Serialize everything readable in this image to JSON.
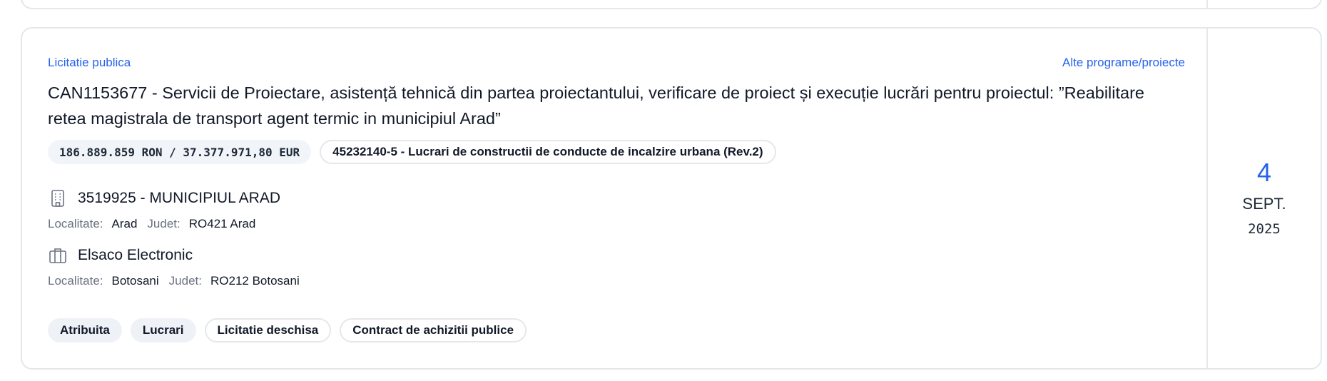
{
  "card": {
    "procedure_type": "Licitatie publica",
    "program": "Alte programe/proiecte",
    "title": "CAN1153677 - Servicii de Proiectare, asistență tehnică din partea proiectantului, verificare de proiect și execuție lucrări pentru proiectul: ”Reabilitare retea magistrala de transport agent termic in municipiul Arad”",
    "value": "186.889.859 RON / 37.377.971,80 EUR",
    "cpv": "45232140-5 - Lucrari de constructii de conducte de incalzire urbana (Rev.2)",
    "authority": {
      "name": "3519925 - MUNICIPIUL ARAD",
      "icon": "building-icon",
      "localitate_label": "Localitate:",
      "localitate": "Arad",
      "judet_label": "Judet:",
      "judet": "RO421 Arad"
    },
    "supplier": {
      "name": "Elsaco Electronic",
      "icon": "briefcase-icon",
      "localitate_label": "Localitate:",
      "localitate": "Botosani",
      "judet_label": "Judet:",
      "judet": "RO212 Botosani"
    },
    "tags": [
      "Atribuita",
      "Lucrari",
      "Licitatie deschisa",
      "Contract de achizitii publice"
    ],
    "date": {
      "day": "4",
      "month": "SEPT.",
      "year": "2025"
    },
    "colors": {
      "accent": "#2563eb",
      "border": "#e5e7eb",
      "chip_bg": "#f1f5f9",
      "muted": "#6b7280"
    }
  }
}
